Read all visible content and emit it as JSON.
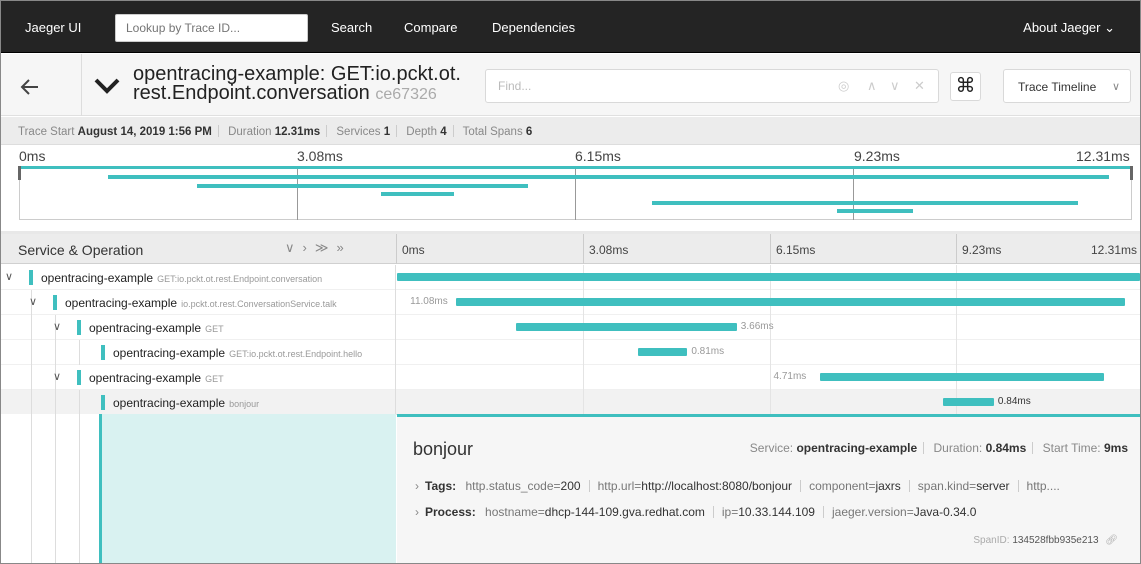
{
  "topnav": {
    "brand": "Jaeger UI",
    "lookup_placeholder": "Lookup by Trace ID...",
    "links": [
      "Search",
      "Compare",
      "Dependencies"
    ],
    "about": "About Jaeger ⌄"
  },
  "header": {
    "title_line1": "opentracing-example: GET:io.pckt.ot.",
    "title_line2": "rest.Endpoint.conversation",
    "trace_id": "ce67326",
    "find_placeholder": "Find...",
    "view_mode": "Trace Timeline",
    "cmd_glyph": "⌘"
  },
  "summary": {
    "trace_start_label": "Trace Start",
    "trace_start": "August 14, 2019 1:56 PM",
    "duration_label": "Duration",
    "duration": "12.31ms",
    "services_label": "Services",
    "services": "1",
    "depth_label": "Depth",
    "depth": "4",
    "total_spans_label": "Total Spans",
    "total_spans": "6"
  },
  "ticks": [
    "0ms",
    "3.08ms",
    "6.15ms",
    "9.23ms",
    "12.31ms"
  ],
  "timeline_header": {
    "service_operation": "Service & Operation"
  },
  "spans": [
    {
      "service": "opentracing-example",
      "operation": "GET:io.pckt.ot.rest.Endpoint.conversation",
      "duration_label": "",
      "start": 0.0,
      "duration": 12.31
    },
    {
      "service": "opentracing-example",
      "operation": "io.pckt.ot.rest.ConversationService.talk",
      "duration_label": "11.08ms",
      "start": 0.98,
      "duration": 11.08
    },
    {
      "service": "opentracing-example",
      "operation": "GET",
      "duration_label": "3.66ms",
      "start": 1.97,
      "duration": 3.66
    },
    {
      "service": "opentracing-example",
      "operation": "GET:io.pckt.ot.rest.Endpoint.hello",
      "duration_label": "0.81ms",
      "start": 4.0,
      "duration": 0.81
    },
    {
      "service": "opentracing-example",
      "operation": "GET",
      "duration_label": "4.71ms",
      "start": 7.0,
      "duration": 4.71
    },
    {
      "service": "opentracing-example",
      "operation": "bonjour",
      "duration_label": "0.84ms",
      "start": 9.05,
      "duration": 0.84
    }
  ],
  "detail": {
    "name": "bonjour",
    "service_label": "Service:",
    "service": "opentracing-example",
    "duration_label": "Duration:",
    "duration": "0.84ms",
    "start_label": "Start Time:",
    "start_time": "9ms",
    "tags_label": "Tags:",
    "tags": [
      {
        "key": "http.status_code",
        "value": "200"
      },
      {
        "key": "http.url",
        "value": "http://localhost:8080/bonjour"
      },
      {
        "key": "component",
        "value": "jaxrs"
      },
      {
        "key": "span.kind",
        "value": "server"
      }
    ],
    "tags_overflow": "http....",
    "process_label": "Process:",
    "process": [
      {
        "key": "hostname",
        "value": "dhcp-144-109.gva.redhat.com"
      },
      {
        "key": "ip",
        "value": "10.33.144.109"
      },
      {
        "key": "jaeger.version",
        "value": "Java-0.34.0"
      }
    ],
    "span_id_label": "SpanID:",
    "span_id": "134528fbb935e213"
  },
  "colors": {
    "accent": "#3fbfbf",
    "nav_bg": "#242424"
  }
}
